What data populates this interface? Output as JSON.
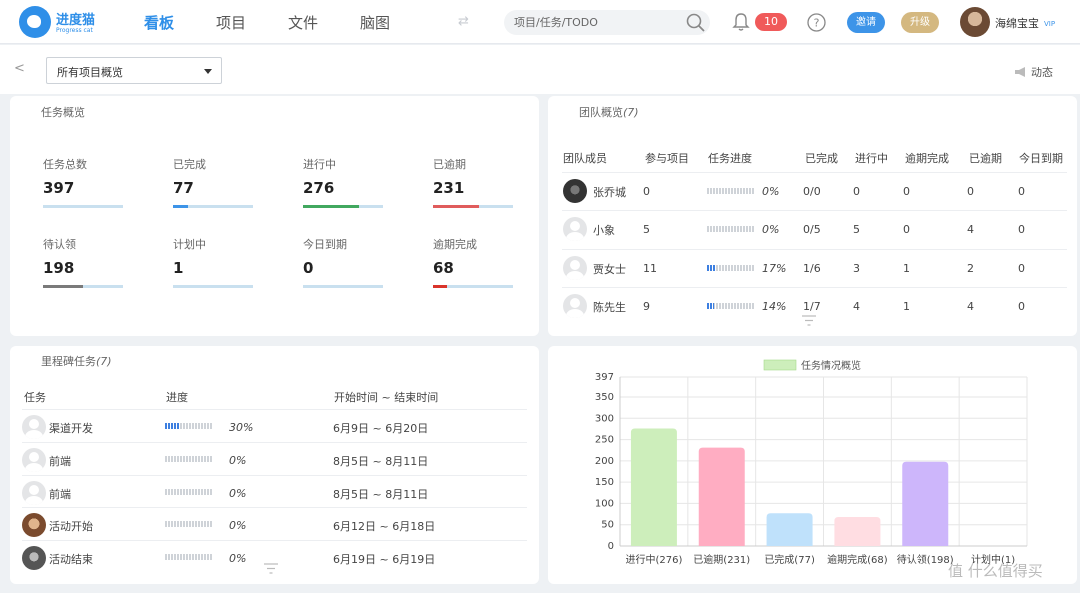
{
  "nav": {
    "logo_title": "进度猫",
    "logo_sub": "Progress cat",
    "tabs": [
      "看板",
      "项目",
      "文件",
      "脑图"
    ],
    "search_placeholder": "项目/任务/TODO",
    "notification_count": "10",
    "invite_label": "邀请",
    "upgrade_label": "升级",
    "user_name": "海绵宝宝",
    "vip_label": "VIP"
  },
  "subbar": {
    "project_select": "所有项目概览",
    "activity_label": "动态"
  },
  "overview": {
    "title": "任务概览",
    "stats": [
      {
        "label": "任务总数",
        "value": "397",
        "fill": 0,
        "color": "#c9e0ef"
      },
      {
        "label": "已完成",
        "value": "77",
        "fill": 0.19,
        "color": "#3d94e8"
      },
      {
        "label": "进行中",
        "value": "276",
        "fill": 0.7,
        "color": "#41a85f"
      },
      {
        "label": "已逾期",
        "value": "231",
        "fill": 0.58,
        "color": "#e05c5c"
      },
      {
        "label": "待认领",
        "value": "198",
        "fill": 0.5,
        "color": "#7a7a7a"
      },
      {
        "label": "计划中",
        "value": "1",
        "fill": 0,
        "color": "#c9e0ef"
      },
      {
        "label": "今日到期",
        "value": "0",
        "fill": 0,
        "color": "#c9e0ef"
      },
      {
        "label": "逾期完成",
        "value": "68",
        "fill": 0.17,
        "color": "#d9342b"
      }
    ]
  },
  "team": {
    "title": "团队概览",
    "count": "(7)",
    "headers": [
      "团队成员",
      "参与项目",
      "任务进度",
      "已完成",
      "进行中",
      "逾期完成",
      "已逾期",
      "今日到期"
    ],
    "rows": [
      {
        "name": "张乔城",
        "projects": "0",
        "progress": 0,
        "pct": "0%",
        "done": "0/0",
        "ongoing": "0",
        "late_done": "0",
        "overdue": "0",
        "today": "0"
      },
      {
        "name": "小象",
        "projects": "5",
        "progress": 0,
        "pct": "0%",
        "done": "0/5",
        "ongoing": "5",
        "late_done": "0",
        "overdue": "4",
        "today": "0"
      },
      {
        "name": "贾女士",
        "projects": "11",
        "progress": 0.17,
        "pct": "17%",
        "done": "1/6",
        "ongoing": "3",
        "late_done": "1",
        "overdue": "2",
        "today": "0"
      },
      {
        "name": "陈先生",
        "projects": "9",
        "progress": 0.14,
        "pct": "14%",
        "done": "1/7",
        "ongoing": "4",
        "late_done": "1",
        "overdue": "4",
        "today": "0"
      }
    ]
  },
  "milestones": {
    "title": "里程碑任务",
    "count": "(7)",
    "headers": [
      "任务",
      "进度",
      "开始时间 ~ 结束时间"
    ],
    "rows": [
      {
        "name": "渠道开发",
        "progress": 0.3,
        "pct": "30%",
        "range": "6月9日 ~ 6月20日"
      },
      {
        "name": "前端",
        "progress": 0,
        "pct": "0%",
        "range": "8月5日 ~ 8月11日"
      },
      {
        "name": "前端",
        "progress": 0,
        "pct": "0%",
        "range": "8月5日 ~ 8月11日"
      },
      {
        "name": "活动开始",
        "progress": 0,
        "pct": "0%",
        "range": "6月12日 ~ 6月18日"
      },
      {
        "name": "活动结束",
        "progress": 0,
        "pct": "0%",
        "range": "6月19日 ~ 6月19日"
      }
    ]
  },
  "chart_data": {
    "type": "bar",
    "legend": "任务情况概览",
    "legend_position": "top",
    "categories": [
      "进行中(276)",
      "已逾期(231)",
      "已完成(77)",
      "逾期完成(68)",
      "待认领(198)",
      "计划中(1)"
    ],
    "values": [
      276,
      231,
      77,
      68,
      198,
      1
    ],
    "colors": [
      "#cdeebb",
      "#ffadc2",
      "#bfe1fb",
      "#ffdde2",
      "#cdb6fb",
      "#e8e8e8"
    ],
    "yticks": [
      0,
      50,
      100,
      150,
      200,
      250,
      300,
      350,
      397
    ],
    "ylim": [
      0,
      397
    ],
    "grid": true
  },
  "watermark": "值 什么值得买"
}
